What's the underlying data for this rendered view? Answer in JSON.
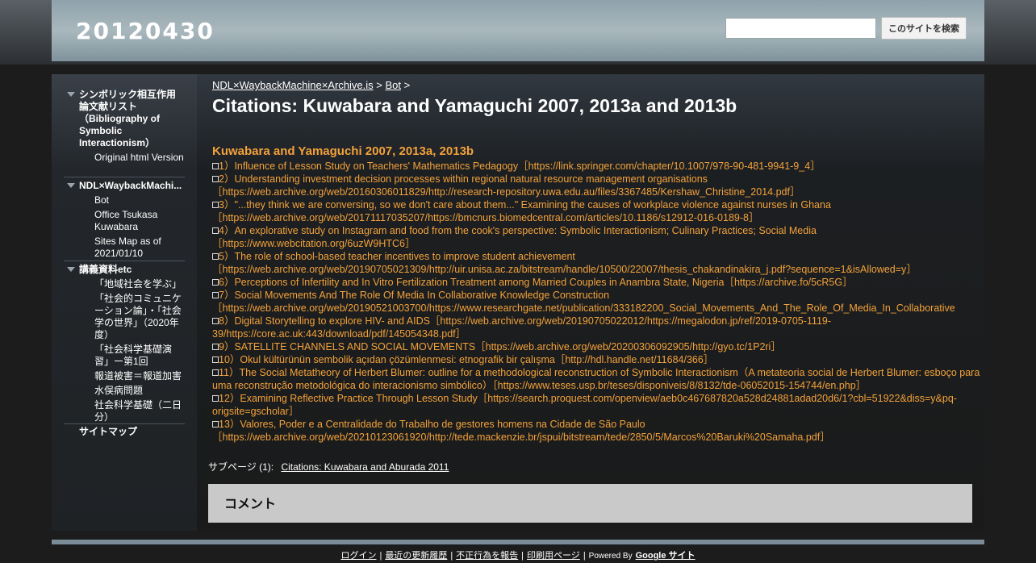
{
  "header": {
    "site_title": "20120430",
    "search_button": "このサイトを検索",
    "search_value": ""
  },
  "sidebar": {
    "groups": [
      {
        "label": "シンボリック相互作用論文献リスト（Bibliography of Symbolic Interactionism）",
        "items": [
          "Original html Version"
        ]
      },
      {
        "label": "NDL×WaybackMachi...",
        "items": [
          "Bot",
          "Office Tsukasa Kuwabara",
          "Sites Map as of 2021/01/10"
        ]
      },
      {
        "label": "講義資料etc",
        "items": [
          "「地域社会を学ぶ」",
          "「社会的コミュニケーション論」・「社会学の世界」（2020年度）",
          "「社会科学基礎演習」ー第1回",
          "報道被害＝報道加害",
          "水俣病問題",
          "社会科学基礎（二日分）"
        ]
      }
    ],
    "sitemap": "サイトマップ"
  },
  "breadcrumb": {
    "root": "NDL×WaybackMachine×Archive.is",
    "sep1": ">",
    "parent": "Bot",
    "sep2": ">"
  },
  "page_title": "Citations: Kuwabara and Yamaguchi 2007, 2013a and 2013b",
  "section_heading": "Kuwabara and Yamaguchi 2007, 2013a, 2013b",
  "citations": [
    "1）Influence of Lesson Study on Teachers' Mathematics Pedagogy［https://link.springer.com/chapter/10.1007/978-90-481-9941-9_4］",
    "2）Understanding investment decision processes within regional natural resource management organisations［https://web.archive.org/web/20160306011829/http://research-repository.uwa.edu.au/files/3367485/Kershaw_Christine_2014.pdf］",
    "3）\"...they think we are conversing, so we don't care about them...\" Examining the causes of workplace violence against nurses in Ghana［https://web.archive.org/web/20171117035207/https://bmcnurs.biomedcentral.com/articles/10.1186/s12912-016-0189-8］",
    "4）An explorative study on Instagram and food from the cook's perspective: Symbolic Interactionism; Culinary Practices; Social Media［https://www.webcitation.org/6uzW9HTC6］",
    "5）The role of school-based teacher incentives to improve student achievement［https://web.archive.org/web/20190705021309/http://uir.unisa.ac.za/bitstream/handle/10500/22007/thesis_chakandinakira_j.pdf?sequence=1&isAllowed=y］",
    "6）Perceptions of Infertility and In Vitro Fertilization Treatment among Married Couples in Anambra State, Nigeria［https://archive.fo/5cR5G］",
    "7）Social Movements And The Role Of Media In Collaborative Knowledge Construction［https://web.archive.org/web/20190521003700/https://www.researchgate.net/publication/333182200_Social_Movements_And_The_Role_Of_Media_In_Collaborative",
    "8）Digital Storytelling to explore HIV- and AIDS［https://web.archive.org/web/20190705022012/https://megalodon.jp/ref/2019-0705-1119-39/https://core.ac.uk:443/download/pdf/145054348.pdf］",
    "9）SATELLITE CHANNELS AND SOCIAL MOVEMENTS［https://web.archive.org/web/20200306092905/http://gyo.tc/1P2ri］",
    "10）Okul kültürünün sembolik açıdan çözümlenmesi: etnografik bir çalışma［http://hdl.handle.net/11684/366］",
    "11）The Social Metatheory of Herbert Blumer: outline for a methodological reconstruction of Symbolic Interactionism（A metateoria social de Herbert Blumer: esboço para uma reconstrução metodológica do interacionismo simbólico）［https://www.teses.usp.br/teses/disponiveis/8/8132/tde-06052015-154744/en.php］",
    "12）Examining Reflective Practice Through Lesson Study［https://search.proquest.com/openview/aeb0c467687820a528d24881adad20d6/1?cbl=51922&diss=y&pq-origsite=gscholar］",
    "13）Valores, Poder e a Centralidade do Trabalho de gestores homens na Cidade de São Paulo［https://web.archive.org/web/20210123061920/http://tede.mackenzie.br/jspui/bitstream/tede/2850/5/Marcos%20Baruki%20Samaha.pdf］"
  ],
  "subpages": {
    "label": "サブページ (1):",
    "link": "Citations: Kuwabara and Aburada 2011"
  },
  "comment": {
    "title": "コメント"
  },
  "footer": {
    "login": "ログイン",
    "recent": "最近の更新履歴",
    "report": "不正行為を報告",
    "print": "印刷用ページ",
    "powered": "Powered By",
    "google": "Google サイト",
    "sep": "|"
  },
  "colors": {
    "accent": "#f3a23a",
    "header": "#9fb1b8",
    "comment_bg": "#c9c9c9"
  }
}
